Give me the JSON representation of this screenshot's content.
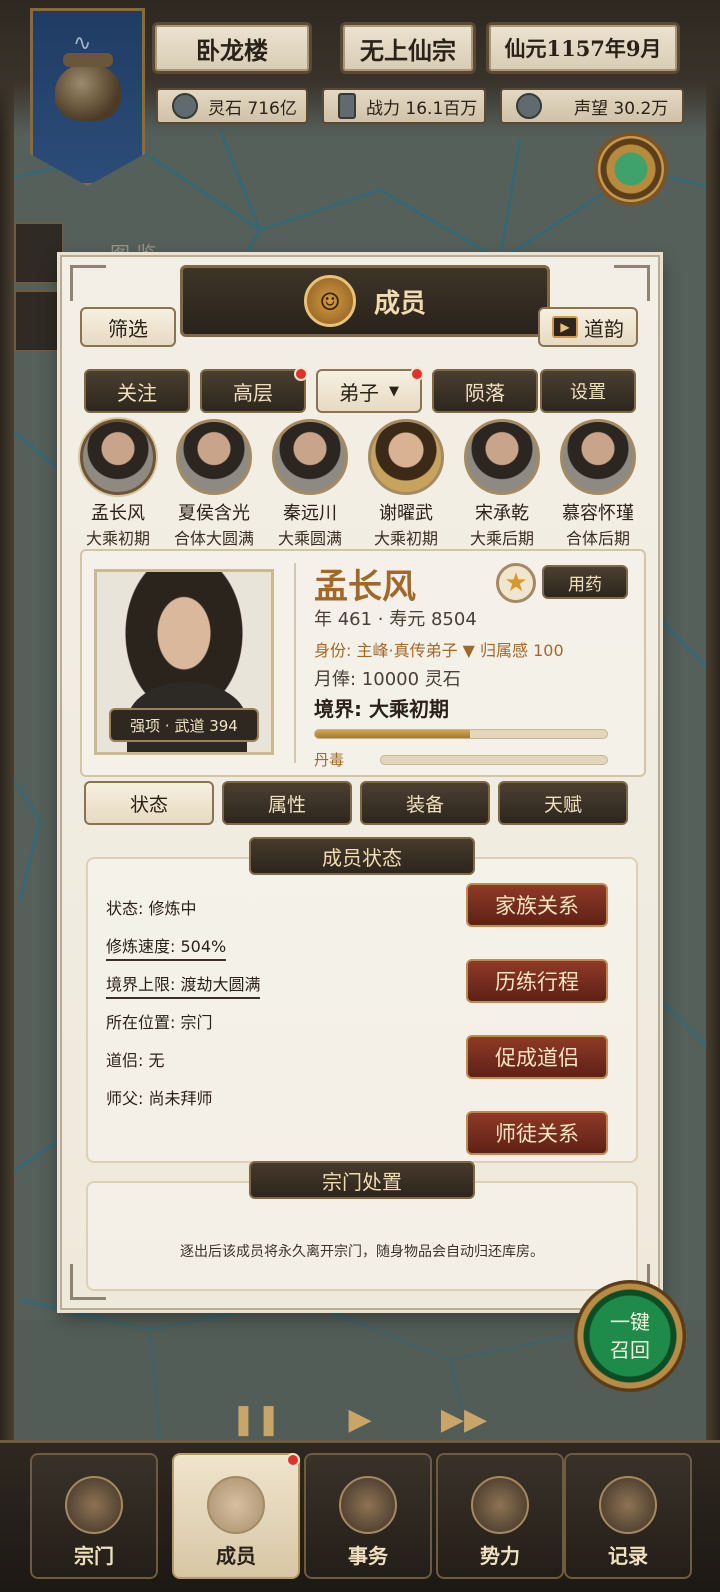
{
  "header": {
    "location": "卧龙楼",
    "sect": "无上仙宗",
    "date": "仙元1157年9月",
    "stats": [
      {
        "icon": "spirit-stone-icon",
        "text": "灵石 716亿"
      },
      {
        "icon": "sword-icon",
        "text": "战力 16.1百万"
      },
      {
        "icon": "prestige-icon",
        "text": "声望 30.2万"
      }
    ],
    "side_label": "图 鉴"
  },
  "panel": {
    "title": "成员",
    "filter_label": "筛选",
    "daoyun_label": "道韵",
    "tabs_top": [
      "关注",
      "高层",
      "弟子",
      "陨落",
      "设置"
    ],
    "members": [
      {
        "name": "孟长风",
        "level": "大乘初期"
      },
      {
        "name": "夏侯含光",
        "level": "合体大圆满"
      },
      {
        "name": "秦远川",
        "level": "大乘圆满"
      },
      {
        "name": "谢曜武",
        "level": "大乘初期"
      },
      {
        "name": "宋承乾",
        "level": "大乘后期"
      },
      {
        "name": "慕容怀瑾",
        "level": "合体后期"
      }
    ],
    "detail": {
      "name": "孟长风",
      "use_medicine": "用药",
      "age_line": "年 461 · 寿元 8504",
      "identity_line": "身份: 主峰·真传弟子 ▼ 归属感 100",
      "salary_line": "月俸: 10000 灵石",
      "realm_line": "境界: 大乘初期",
      "strength": "强项 · 武道 394",
      "progress": 0.53,
      "poison_label": "丹毒",
      "poison": 0.0
    },
    "tabs": [
      "状态",
      "属性",
      "装备",
      "天赋"
    ],
    "status_section": {
      "title": "成员状态",
      "rows": [
        "状态: 修炼中",
        "修炼速度: 504%",
        "境界上限: 渡劫大圆满",
        "所在位置: 宗门",
        "道侣: 无",
        "师父: 尚未拜师"
      ],
      "buttons": [
        "家族关系",
        "历练行程",
        "促成道侣",
        "师徒关系"
      ]
    },
    "sect_section": {
      "title": "宗门处置",
      "text": "逐出后该成员将永久离开宗门，随身物品会自动归还库房。"
    }
  },
  "recall": {
    "line1": "一键",
    "line2": "召回"
  },
  "bottom_nav": [
    "宗门",
    "成员",
    "事务",
    "势力",
    "记录"
  ],
  "colors": {
    "accent_gold": "#a0692a",
    "red_button": "#8f3a26",
    "notify": "#e0312b"
  }
}
